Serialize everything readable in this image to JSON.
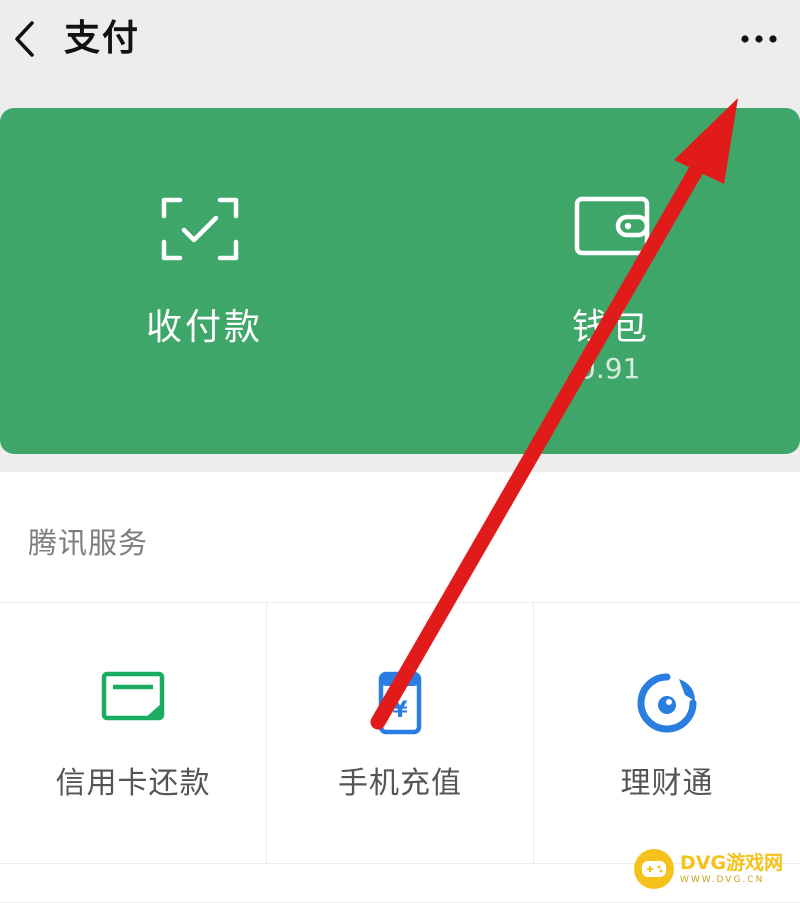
{
  "topbar": {
    "title": "支付",
    "back_icon": "chevron-left-icon",
    "more_icon": "more-dots-icon"
  },
  "payment_card": {
    "color": "#3fa66a",
    "actions": [
      {
        "label": "收付款",
        "icon": "scan-check-icon"
      },
      {
        "label": "钱包",
        "sub": "0.91",
        "icon": "wallet-icon"
      }
    ]
  },
  "services": {
    "section_label": "腾讯服务",
    "items": [
      {
        "label": "信用卡还款",
        "icon": "credit-card-icon",
        "color": "#1aad5f"
      },
      {
        "label": "手机充值",
        "icon": "phone-recharge-icon",
        "color": "#2a7de1"
      },
      {
        "label": "理财通",
        "icon": "wealth-icon",
        "color": "#2a7de1"
      }
    ]
  },
  "annotation": {
    "arrow_color": "#e11a1a"
  },
  "watermark": {
    "main": "DVG游戏网",
    "sub": "WWW.DVG.CN"
  }
}
